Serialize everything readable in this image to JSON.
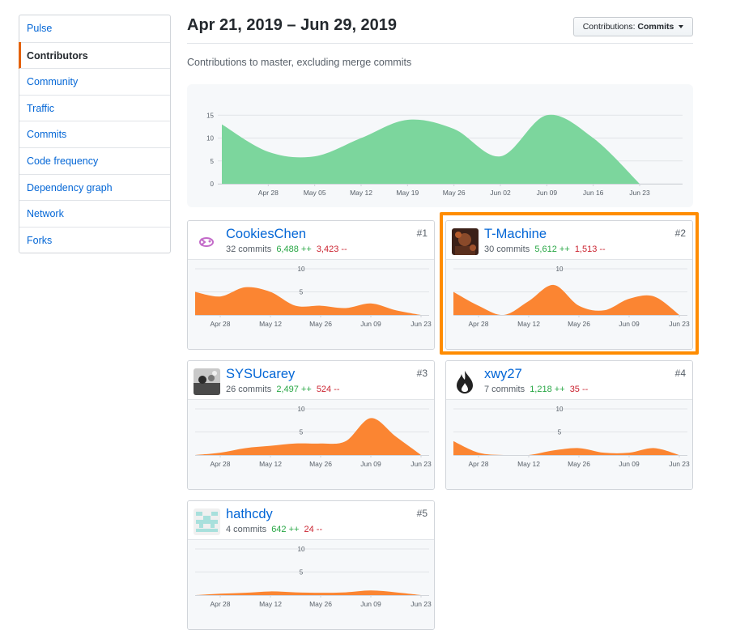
{
  "sidebar": {
    "items": [
      {
        "label": "Pulse"
      },
      {
        "label": "Contributors",
        "selected": true
      },
      {
        "label": "Community"
      },
      {
        "label": "Traffic"
      },
      {
        "label": "Commits"
      },
      {
        "label": "Code frequency"
      },
      {
        "label": "Dependency graph"
      },
      {
        "label": "Network"
      },
      {
        "label": "Forks"
      }
    ]
  },
  "header": {
    "date_range": "Apr 21, 2019 – Jun 29, 2019",
    "select_prefix": "Contributions:",
    "select_value": "Commits",
    "subtitle": "Contributions to master, excluding merge commits"
  },
  "colors": {
    "main_area": "#7cd69d",
    "contrib_area": "#fb8532",
    "highlight": "#ff8c00"
  },
  "chart_data": [
    {
      "type": "area",
      "id": "main",
      "x": [
        "Apr 21",
        "Apr 28",
        "May 05",
        "May 12",
        "May 19",
        "May 26",
        "Jun 02",
        "Jun 09",
        "Jun 16",
        "Jun 23"
      ],
      "x_ticks": [
        "Apr 28",
        "May 05",
        "May 12",
        "May 19",
        "May 26",
        "Jun 02",
        "Jun 09",
        "Jun 16",
        "Jun 23"
      ],
      "y_ticks": [
        0,
        5,
        10,
        15
      ],
      "ylim": [
        0,
        17
      ],
      "series": [
        {
          "values": [
            13,
            7,
            6,
            10,
            14,
            12,
            6,
            15,
            10,
            0
          ]
        }
      ]
    },
    {
      "type": "area",
      "id": "c1",
      "x": [
        "Apr 21",
        "Apr 28",
        "May 05",
        "May 12",
        "May 19",
        "May 26",
        "Jun 02",
        "Jun 09",
        "Jun 16",
        "Jun 23"
      ],
      "x_ticks": [
        "Apr 28",
        "May 12",
        "May 26",
        "Jun 09",
        "Jun 23"
      ],
      "y_ticks": [
        5,
        10
      ],
      "ylim": [
        0,
        10
      ],
      "series": [
        {
          "values": [
            5,
            4,
            6,
            5,
            2,
            2,
            1.5,
            2.5,
            1,
            0
          ]
        }
      ]
    },
    {
      "type": "area",
      "id": "c2",
      "x": [
        "Apr 21",
        "Apr 28",
        "May 05",
        "May 12",
        "May 19",
        "May 26",
        "Jun 02",
        "Jun 09",
        "Jun 16",
        "Jun 23"
      ],
      "x_ticks": [
        "Apr 28",
        "May 12",
        "May 26",
        "Jun 09",
        "Jun 23"
      ],
      "y_ticks": [
        5,
        10
      ],
      "ylim": [
        0,
        10
      ],
      "series": [
        {
          "values": [
            5,
            2,
            0,
            3,
            6.5,
            2,
            1,
            3.5,
            4,
            0
          ]
        }
      ]
    },
    {
      "type": "area",
      "id": "c3",
      "x": [
        "Apr 21",
        "Apr 28",
        "May 05",
        "May 12",
        "May 19",
        "May 26",
        "Jun 02",
        "Jun 09",
        "Jun 16",
        "Jun 23"
      ],
      "x_ticks": [
        "Apr 28",
        "May 12",
        "May 26",
        "Jun 09",
        "Jun 23"
      ],
      "y_ticks": [
        5,
        10
      ],
      "ylim": [
        0,
        10
      ],
      "series": [
        {
          "values": [
            0,
            0.5,
            1.5,
            2,
            2.5,
            2.5,
            3,
            8,
            4,
            0
          ]
        }
      ]
    },
    {
      "type": "area",
      "id": "c4",
      "x": [
        "Apr 21",
        "Apr 28",
        "May 05",
        "May 12",
        "May 19",
        "May 26",
        "Jun 02",
        "Jun 09",
        "Jun 16",
        "Jun 23"
      ],
      "x_ticks": [
        "Apr 28",
        "May 12",
        "May 26",
        "Jun 09",
        "Jun 23"
      ],
      "y_ticks": [
        5,
        10
      ],
      "ylim": [
        0,
        10
      ],
      "series": [
        {
          "values": [
            3,
            0.5,
            0,
            0,
            1,
            1.5,
            0.5,
            0.5,
            1.5,
            0
          ]
        }
      ]
    },
    {
      "type": "area",
      "id": "c5",
      "x": [
        "Apr 21",
        "Apr 28",
        "May 05",
        "May 12",
        "May 19",
        "May 26",
        "Jun 02",
        "Jun 09",
        "Jun 16",
        "Jun 23"
      ],
      "x_ticks": [
        "Apr 28",
        "May 12",
        "May 26",
        "Jun 09",
        "Jun 23"
      ],
      "y_ticks": [
        5,
        10
      ],
      "ylim": [
        0,
        10
      ],
      "series": [
        {
          "values": [
            0,
            0.3,
            0.5,
            0.8,
            0.6,
            0.5,
            0.6,
            1,
            0.6,
            0
          ]
        }
      ]
    }
  ],
  "contributors": [
    {
      "name": "CookiesChen",
      "commits": "32 commits",
      "additions": "6,488 ++",
      "deletions": "3,423 --",
      "rank": "#1"
    },
    {
      "name": "T-Machine",
      "commits": "30 commits",
      "additions": "5,612 ++",
      "deletions": "1,513 --",
      "rank": "#2"
    },
    {
      "name": "SYSUcarey",
      "commits": "26 commits",
      "additions": "2,497 ++",
      "deletions": "524 --",
      "rank": "#3"
    },
    {
      "name": "xwy27",
      "commits": "7 commits",
      "additions": "1,218 ++",
      "deletions": "35 --",
      "rank": "#4"
    },
    {
      "name": "hathcdy",
      "commits": "4 commits",
      "additions": "642 ++",
      "deletions": "24 --",
      "rank": "#5"
    }
  ]
}
